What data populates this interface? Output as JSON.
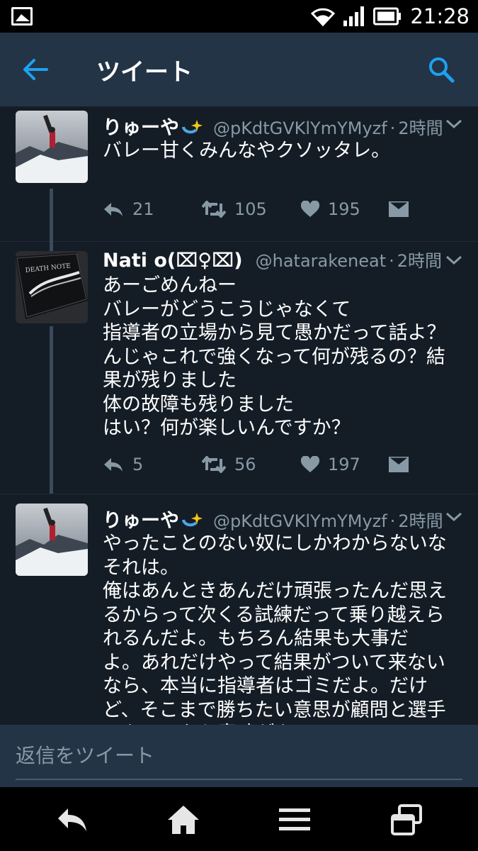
{
  "status_bar": {
    "time": "21:28",
    "icons": [
      "picture-icon",
      "wifi-icon",
      "signal-icon",
      "battery-icon"
    ]
  },
  "app_bar": {
    "title": "ツイート",
    "icons": [
      "back-arrow-icon",
      "search-icon"
    ]
  },
  "tweets": [
    {
      "name": "りゅーや",
      "handle": "@pKdtGVKlYmYMyzf",
      "time": "2時間",
      "text": "バレー甘くみんなやクソッタレ。",
      "replies": "21",
      "retweets": "105",
      "likes": "195"
    },
    {
      "name": "Nati o(⌧♀⌧)",
      "handle": "@hatarakeneat",
      "time": "2時間",
      "text": "あーごめんねー\nバレーがどうこうじゃなくて\n指導者の立場から見て愚かだって話よ？\nんじゃこれで強くなって何が残るの？結\n果が残りました\n体の故障も残りました\nはい？何が楽しいんですか？",
      "replies": "5",
      "retweets": "56",
      "likes": "197"
    },
    {
      "name": "りゅーや",
      "handle": "@pKdtGVKlYmYMyzf",
      "time": "2時間",
      "text": "やったことのない奴にしかわからないな\nそれは。\n俺はあんときあんだけ頑張ったんだ思え\nるからって次くる試練だって乗り越えら\nれるんだよ。もちろん結果も大事だ\nよ。あれだけやって結果がついて来ない\nなら、本当に指導者はゴミだよ。だけ\nど、そこまで勝ちたい意思が顧問と選手\nにあるのなら意味がある"
    }
  ],
  "reply_bar": {
    "placeholder": "返信をツイート"
  },
  "nav_bar": {
    "icons": [
      "back-icon",
      "home-icon",
      "menu-icon",
      "recent-apps-icon"
    ]
  },
  "colors": {
    "background": "#141d26",
    "header": "#243447",
    "accent": "#1da1f2",
    "secondary_text": "#8899a6"
  }
}
